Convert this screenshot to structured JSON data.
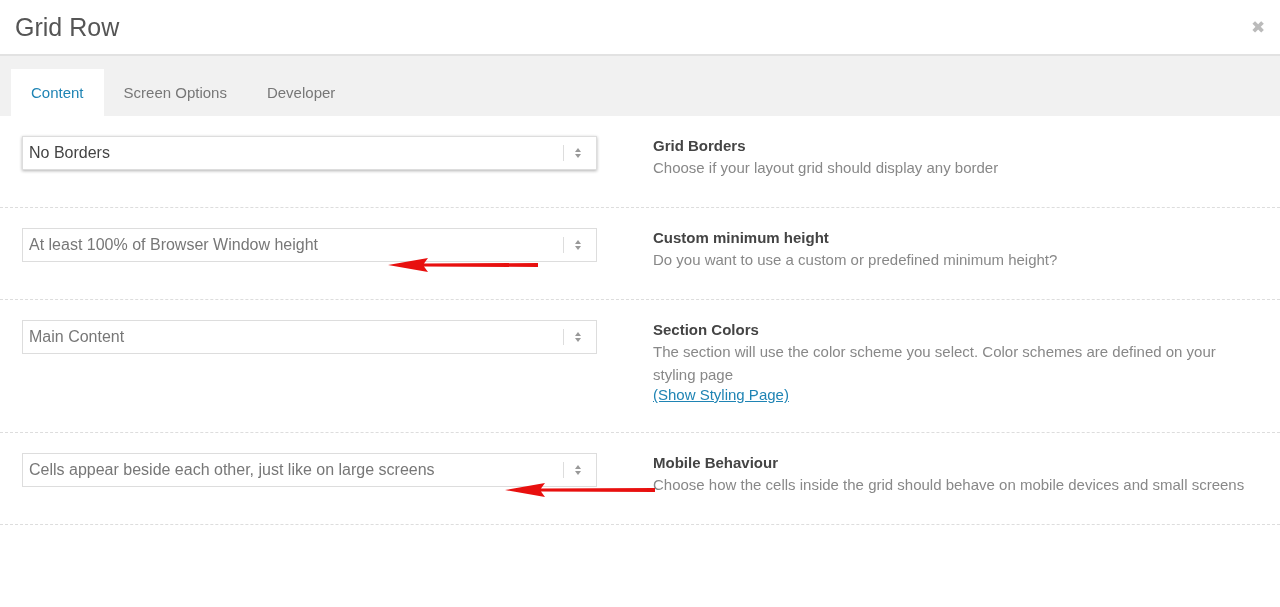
{
  "window": {
    "title": "Grid Row",
    "close": "✖"
  },
  "tabs": [
    {
      "label": "Content",
      "selected": true
    },
    {
      "label": "Screen Options",
      "selected": false
    },
    {
      "label": "Developer",
      "selected": false
    }
  ],
  "settings": [
    {
      "value": "No Borders",
      "focused": true,
      "highlighted": false,
      "label": "Grid Borders",
      "description": "Choose if your layout grid should display any border"
    },
    {
      "value": "At least 100% of Browser Window height",
      "focused": false,
      "highlighted": true,
      "label": "Custom minimum height",
      "description": "Do you want to use a custom or predefined minimum height?"
    },
    {
      "value": "Main Content",
      "focused": false,
      "highlighted": false,
      "label": "Section Colors",
      "description": "The section will use the color scheme you select. Color schemes are defined on your styling page",
      "link": "(Show Styling Page)"
    },
    {
      "value": "Cells appear beside each other, just like on large screens",
      "focused": false,
      "highlighted": true,
      "label": "Mobile Behaviour",
      "description": "Choose how the cells inside the grid should behave on mobile devices and small screens"
    }
  ]
}
